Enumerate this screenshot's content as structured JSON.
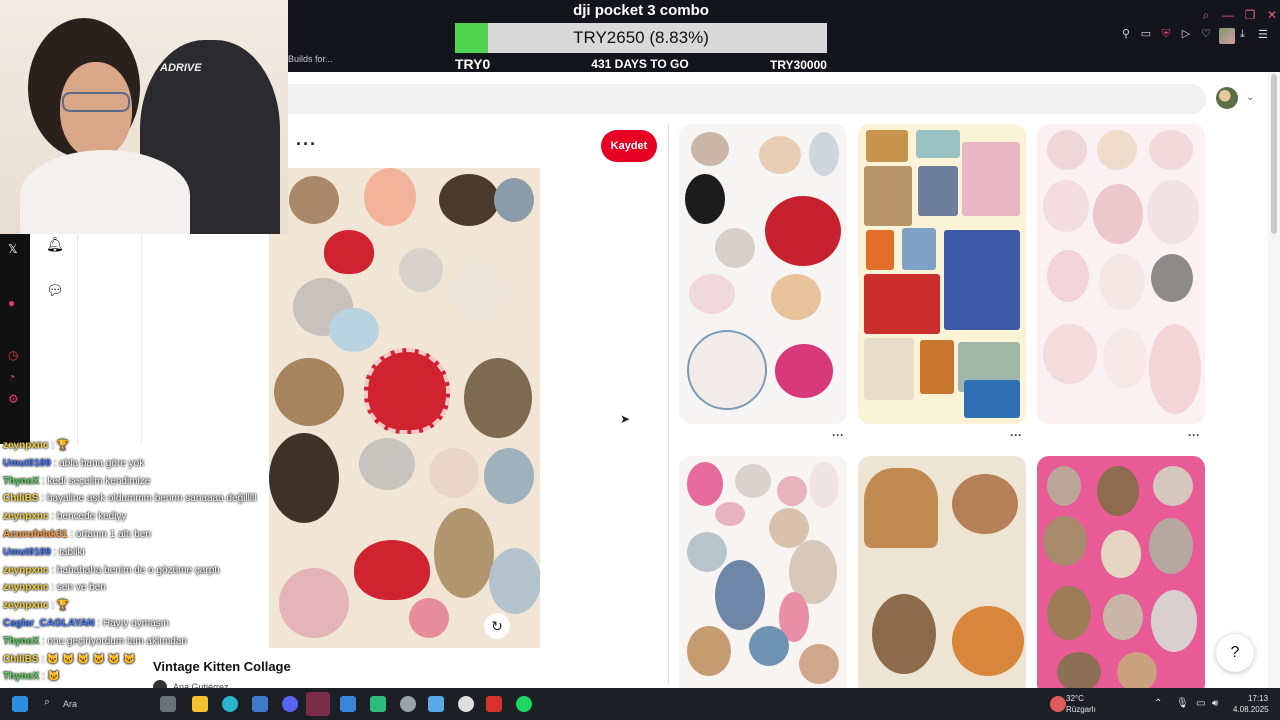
{
  "stream_goal": {
    "title": "dji pocket 3 combo",
    "amount": "TRY2650 (8.83%)",
    "progress_fraction": 0.0883,
    "min_label": "TRY0",
    "days_label": "431 DAYS TO GO",
    "max_label": "TRY30000"
  },
  "browser": {
    "builds_label": "Builds for..."
  },
  "pin": {
    "save_label": "Kaydet",
    "more_label": "···",
    "title": "Vintage Kitten Collage",
    "author": "Ana Gutiérrez"
  },
  "chat": [
    {
      "user": "zeynpxnc",
      "msg": ": 🏆",
      "color": "yellow"
    },
    {
      "user": "Umut0189",
      "msg": ": abla bana göre yok",
      "color": "blue"
    },
    {
      "user": "ThyneX",
      "msg": ": kedi seçelim kendimize",
      "color": "green"
    },
    {
      "user": "ChiliBS",
      "msg": ": hayaline aşık oldummm bennn sanaaaa değilllll",
      "color": "yellow"
    },
    {
      "user": "zeynpxnc",
      "msg": ": bencede kediyy",
      "color": "yellow"
    },
    {
      "user": "Acucufelak31",
      "msg": ": ortanın 1 altı ben",
      "color": "orange"
    },
    {
      "user": "Umut0189",
      "msg": ": tabiiki",
      "color": "blue"
    },
    {
      "user": "zeynpxnc",
      "msg": ": hahahaha benim de o gözüme çarptı",
      "color": "yellow"
    },
    {
      "user": "zeynpxnc",
      "msg": ": sen ve ben",
      "color": "yellow"
    },
    {
      "user": "zeynpxnc",
      "msg": ": 🏆",
      "color": "yellow"
    },
    {
      "user": "Caglar_CAGLAYAN",
      "msg": ": Hayıy oymaşın",
      "color": "blue"
    },
    {
      "user": "ThyneX",
      "msg": ": onu geçiriyordum tam aklımdan",
      "color": "green"
    },
    {
      "user": "ChiliBS",
      "msg": ": 🐱 🐱 🐱 🐱 🐱 🐱",
      "color": "yellow"
    },
    {
      "user": "ThyneX",
      "msg": ": 🐱",
      "color": "green"
    },
    {
      "user": "Umut0189",
      "msg": ": ❤",
      "color": "blue"
    }
  ],
  "taskbar": {
    "search_label": "Ara",
    "weather_temp": "32°C",
    "weather_desc": "Rüzgarlı",
    "time": "17:13",
    "date": "4.08.2025"
  },
  "colors": {
    "pinterest_red": "#e60023",
    "goal_green": "#4fd34f",
    "taskbar_bg": "#1c1f26"
  }
}
